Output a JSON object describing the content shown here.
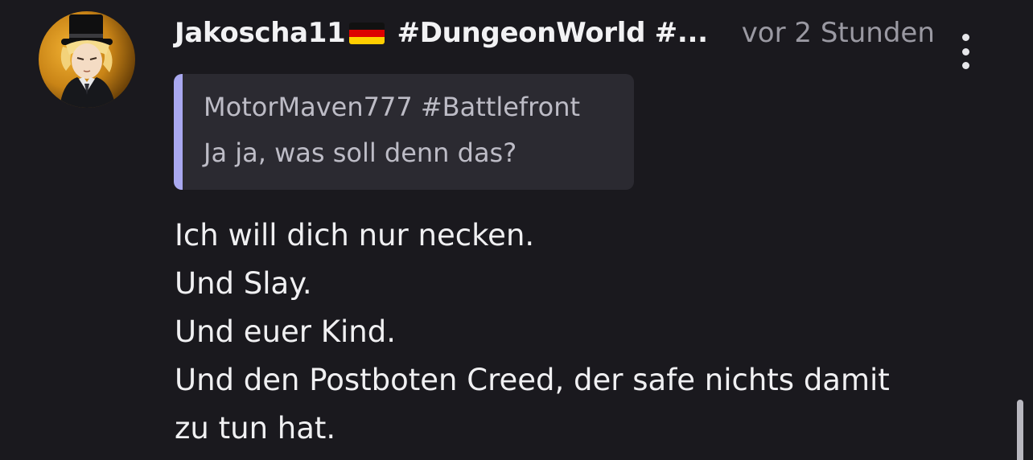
{
  "comment": {
    "author": "Jakoscha11",
    "author_flag": "germany-flag",
    "tags": "#DungeonWorld #...",
    "timestamp": "vor 2 Stunden",
    "quote": {
      "author": "MotorMaven777 #Battlefront",
      "text": "Ja ja, was soll denn das?"
    },
    "body_lines": [
      "Ich will dich nur necken.",
      "Und Slay.",
      "Und euer Kind.",
      "Und den Postboten Creed, der safe nichts damit",
      "zu tun hat."
    ]
  },
  "icons": {
    "more": "more-vertical-icon",
    "avatar": "avatar-image"
  },
  "colors": {
    "background": "#1a191e",
    "quote_background": "#2b2a31",
    "quote_accent": "#a9a8f0",
    "muted_text": "#9a99a2",
    "primary_text": "#f0f0f2"
  }
}
